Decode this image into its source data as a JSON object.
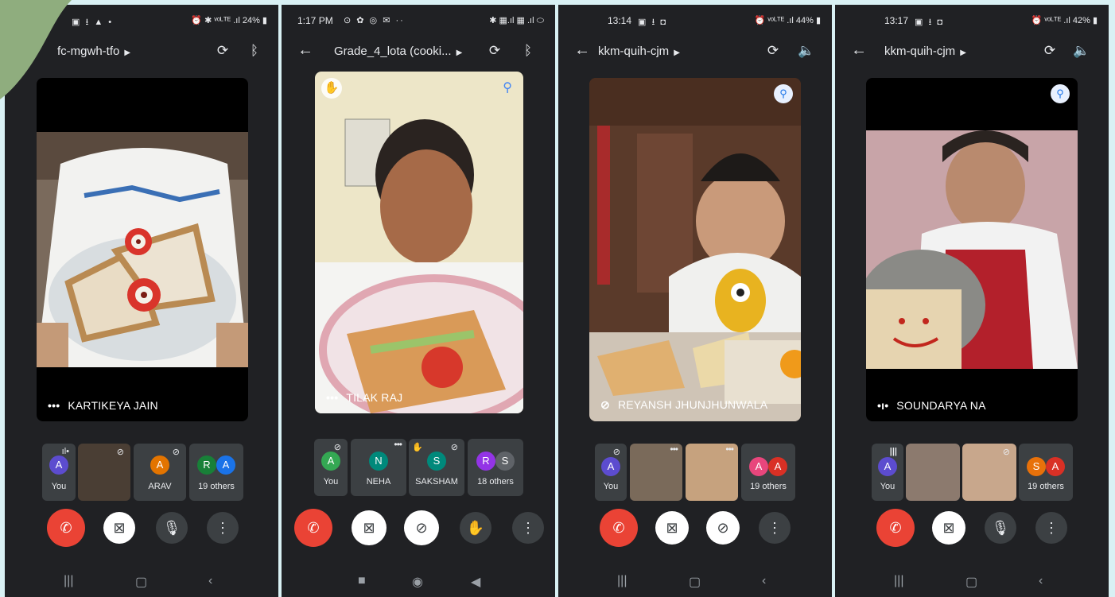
{
  "phones": [
    {
      "status": {
        "time": "",
        "icons": "▣ ⭳ ▲ •",
        "right": "⏰ ✱ ᵛᵒᴸᵀᴱ .ıl 24% ▮"
      },
      "meeting_title": "fc-mgwh-tfo",
      "speaker": "KARTIKEYA JAIN",
      "tiles": [
        {
          "label": "You",
          "initials": [
            "A"
          ],
          "colors": [
            "#5c4ccf"
          ]
        },
        {
          "label": "",
          "video": true
        },
        {
          "label": "ARAV",
          "initials": [
            "A"
          ],
          "colors": [
            "#e37400"
          ]
        },
        {
          "label": "19 others",
          "initials": [
            "R",
            "A"
          ],
          "colors": [
            "#188038",
            "#1a73e8"
          ]
        }
      ]
    },
    {
      "status": {
        "time": "1:17 PM",
        "icons": "⊙ ✿ ◎ ✉ ··",
        "right": "✱ ▦.ıl ▦ .ıl ⬭"
      },
      "meeting_title": "Grade_4_lota (cooki...",
      "speaker": "TILAK RAJ",
      "tiles": [
        {
          "label": "You",
          "initials": [
            "A"
          ],
          "colors": [
            "#34a853"
          ]
        },
        {
          "label": "NEHA",
          "initials": [
            "N"
          ],
          "colors": [
            "#00897b"
          ]
        },
        {
          "label": "SAKSHAM",
          "initials": [
            "S"
          ],
          "colors": [
            "#00897b"
          ]
        },
        {
          "label": "18 others",
          "initials": [
            "R",
            "S"
          ],
          "colors": [
            "#9334e6",
            "#5f6368"
          ]
        }
      ]
    },
    {
      "status": {
        "time": "13:14",
        "icons": "▣ ⭳ ◘",
        "right": "⏰ ᵛᵒᴸᵀᴱ .ıl 44% ▮"
      },
      "meeting_title": "kkm-quih-cjm",
      "speaker": "REYANSH JHUNJHUNWALA",
      "tiles": [
        {
          "label": "You",
          "initials": [
            "A"
          ],
          "colors": [
            "#5c4ccf"
          ]
        },
        {
          "label": "",
          "video": true
        },
        {
          "label": "",
          "video": true
        },
        {
          "label": "19 others",
          "initials": [
            "A",
            "A"
          ],
          "colors": [
            "#e8467c",
            "#d93025"
          ]
        }
      ]
    },
    {
      "status": {
        "time": "13:17",
        "icons": "▣ ⭳ ◘",
        "right": "⏰ ᵛᵒᴸᵀᴱ .ıl 42% ▮"
      },
      "meeting_title": "kkm-quih-cjm",
      "speaker": "SOUNDARYA NA",
      "tiles": [
        {
          "label": "You",
          "initials": [
            "A"
          ],
          "colors": [
            "#5c4ccf"
          ]
        },
        {
          "label": "",
          "video": true
        },
        {
          "label": "",
          "video": true
        },
        {
          "label": "19 others",
          "initials": [
            "S",
            "A"
          ],
          "colors": [
            "#e8710a",
            "#d93025"
          ]
        }
      ]
    }
  ],
  "colors": {
    "end_call": "#ea4335",
    "background": "#d9f1f4",
    "phone_bg": "#202124"
  }
}
